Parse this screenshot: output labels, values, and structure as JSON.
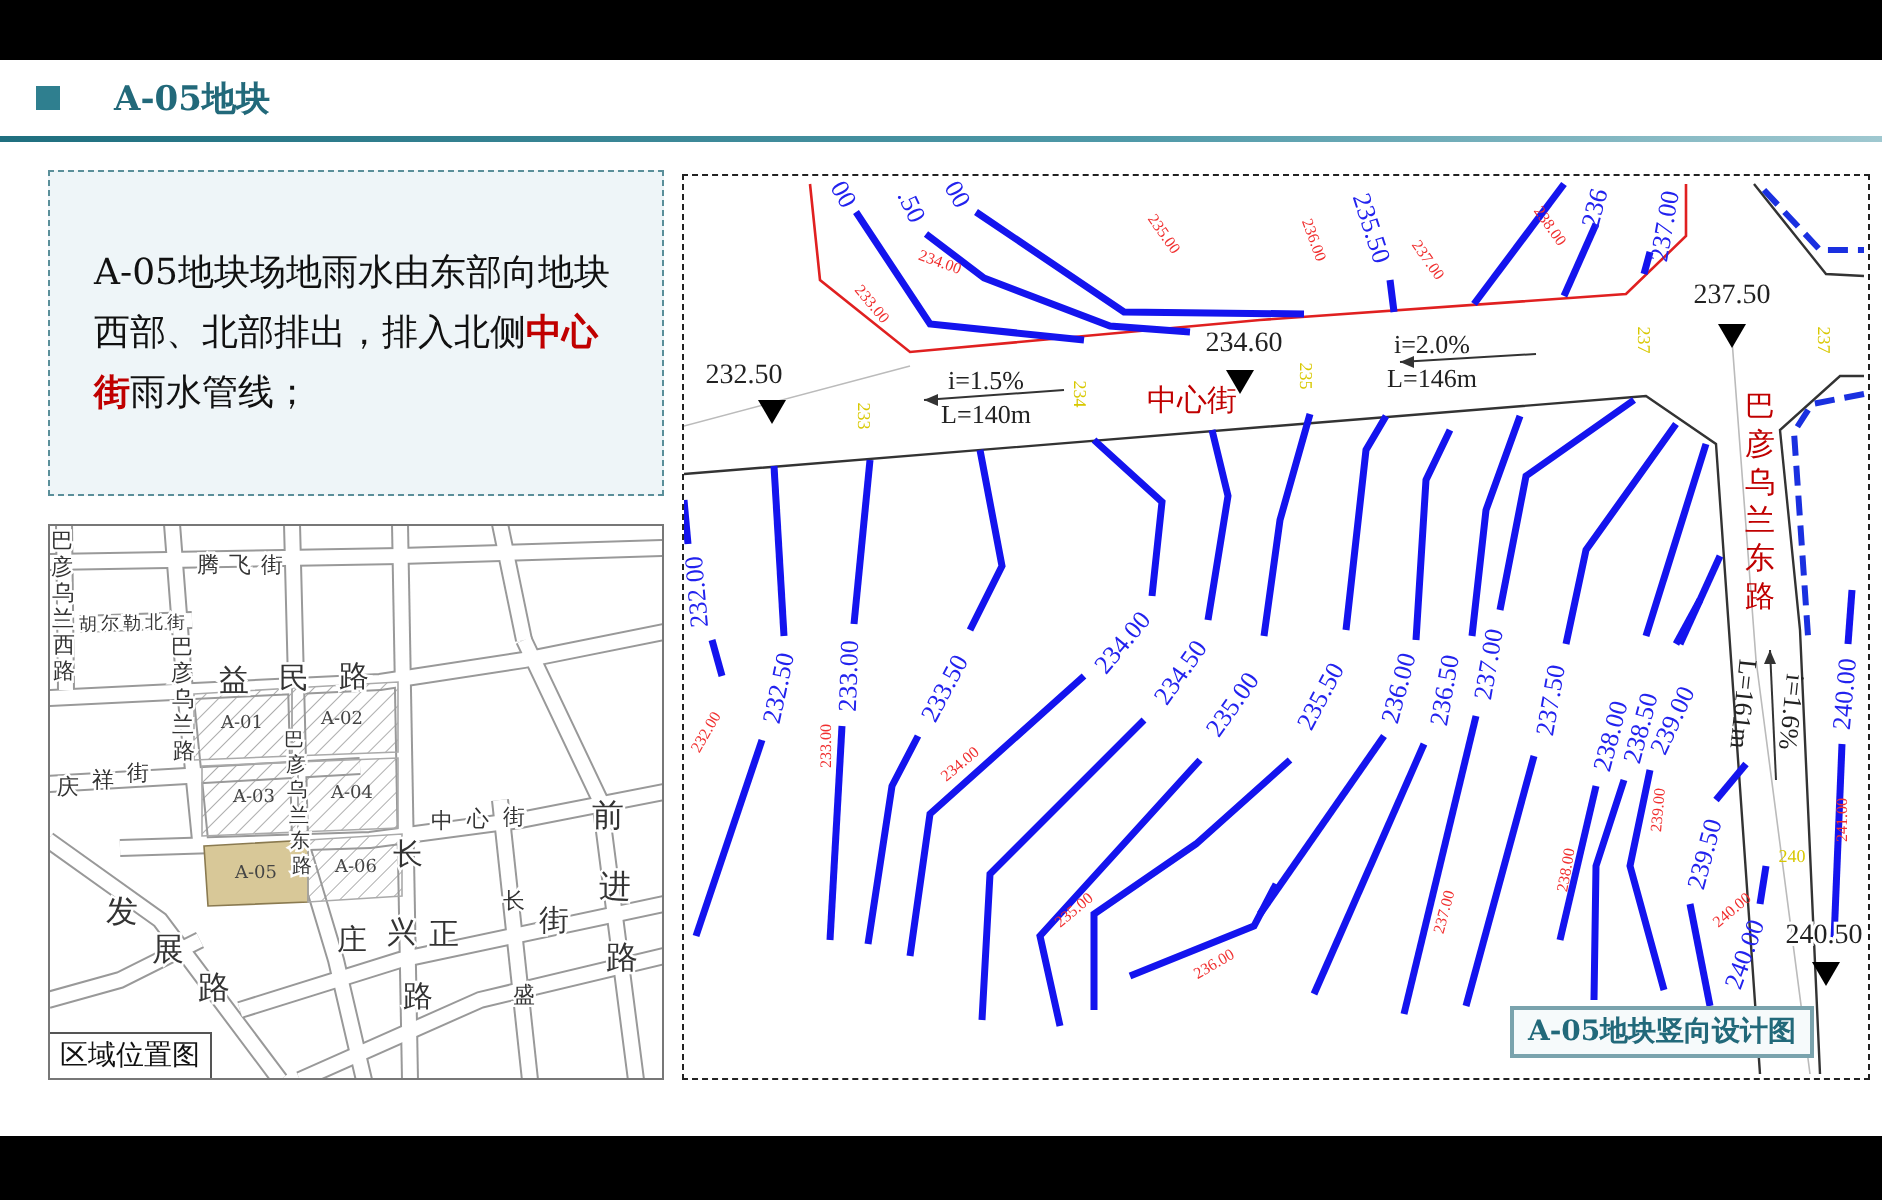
{
  "header": {
    "title": "A-05地块"
  },
  "description": "A-05地块场地雨水由东部向地块西部、北部排出，排入北侧**中心街**雨水管线；",
  "location_map": {
    "roads": [
      "巴彦乌兰西路",
      "腾飞街",
      "胡尔勒北街",
      "巴彦乌兰路",
      "益民路",
      "庆祥街",
      "巴彦乌兰东路",
      "中心街",
      "前进路",
      "长",
      "长",
      "发",
      "庄",
      "兴",
      "正",
      "街",
      "展",
      "路",
      "路",
      "盛"
    ],
    "parcels": [
      {
        "label": "A-01",
        "selected": false
      },
      {
        "label": "A-02",
        "selected": false
      },
      {
        "label": "A-03",
        "selected": false
      },
      {
        "label": "A-04",
        "selected": false
      },
      {
        "label": "A-05",
        "selected": true
      },
      {
        "label": "A-06",
        "selected": false
      }
    ],
    "caption": "区域位置图"
  },
  "design_map": {
    "elevation_points": [
      "232.50",
      "234.60",
      "237.50",
      "240.50"
    ],
    "slopes": [
      {
        "grade": "i=1.5%",
        "length": "L=140m"
      },
      {
        "grade": "i=2.0%",
        "length": "L=146m"
      },
      {
        "grade": "i=1.6%",
        "length": "L=161m"
      }
    ],
    "road_names": [
      "中心街",
      "巴彦乌兰东路"
    ],
    "design_contours": [
      "232.00",
      "232.50",
      "233.00",
      "233.50",
      "234.00",
      "234.50",
      "235.00",
      "235.50",
      "236.00",
      "236.50",
      "237.00",
      "237.50",
      "238.00",
      "238.50",
      "239.00",
      "239.50",
      "240.00",
      "240.00"
    ],
    "top_contour_labels": [
      "00",
      ".50",
      "00",
      "235.50",
      "236",
      "237.00"
    ],
    "existing_elevations": [
      "233.00",
      "234.00",
      "235.00",
      "236.00",
      "237.00",
      "238.00",
      "232.00",
      "233.00",
      "234.00",
      "235.00",
      "236.00",
      "237.00",
      "238.00",
      "239.00",
      "240.00",
      "241.00"
    ],
    "grid_marks": [
      "233",
      "234",
      "235",
      "237",
      "237",
      "240"
    ],
    "title": "A-05地块竖向设计图"
  }
}
